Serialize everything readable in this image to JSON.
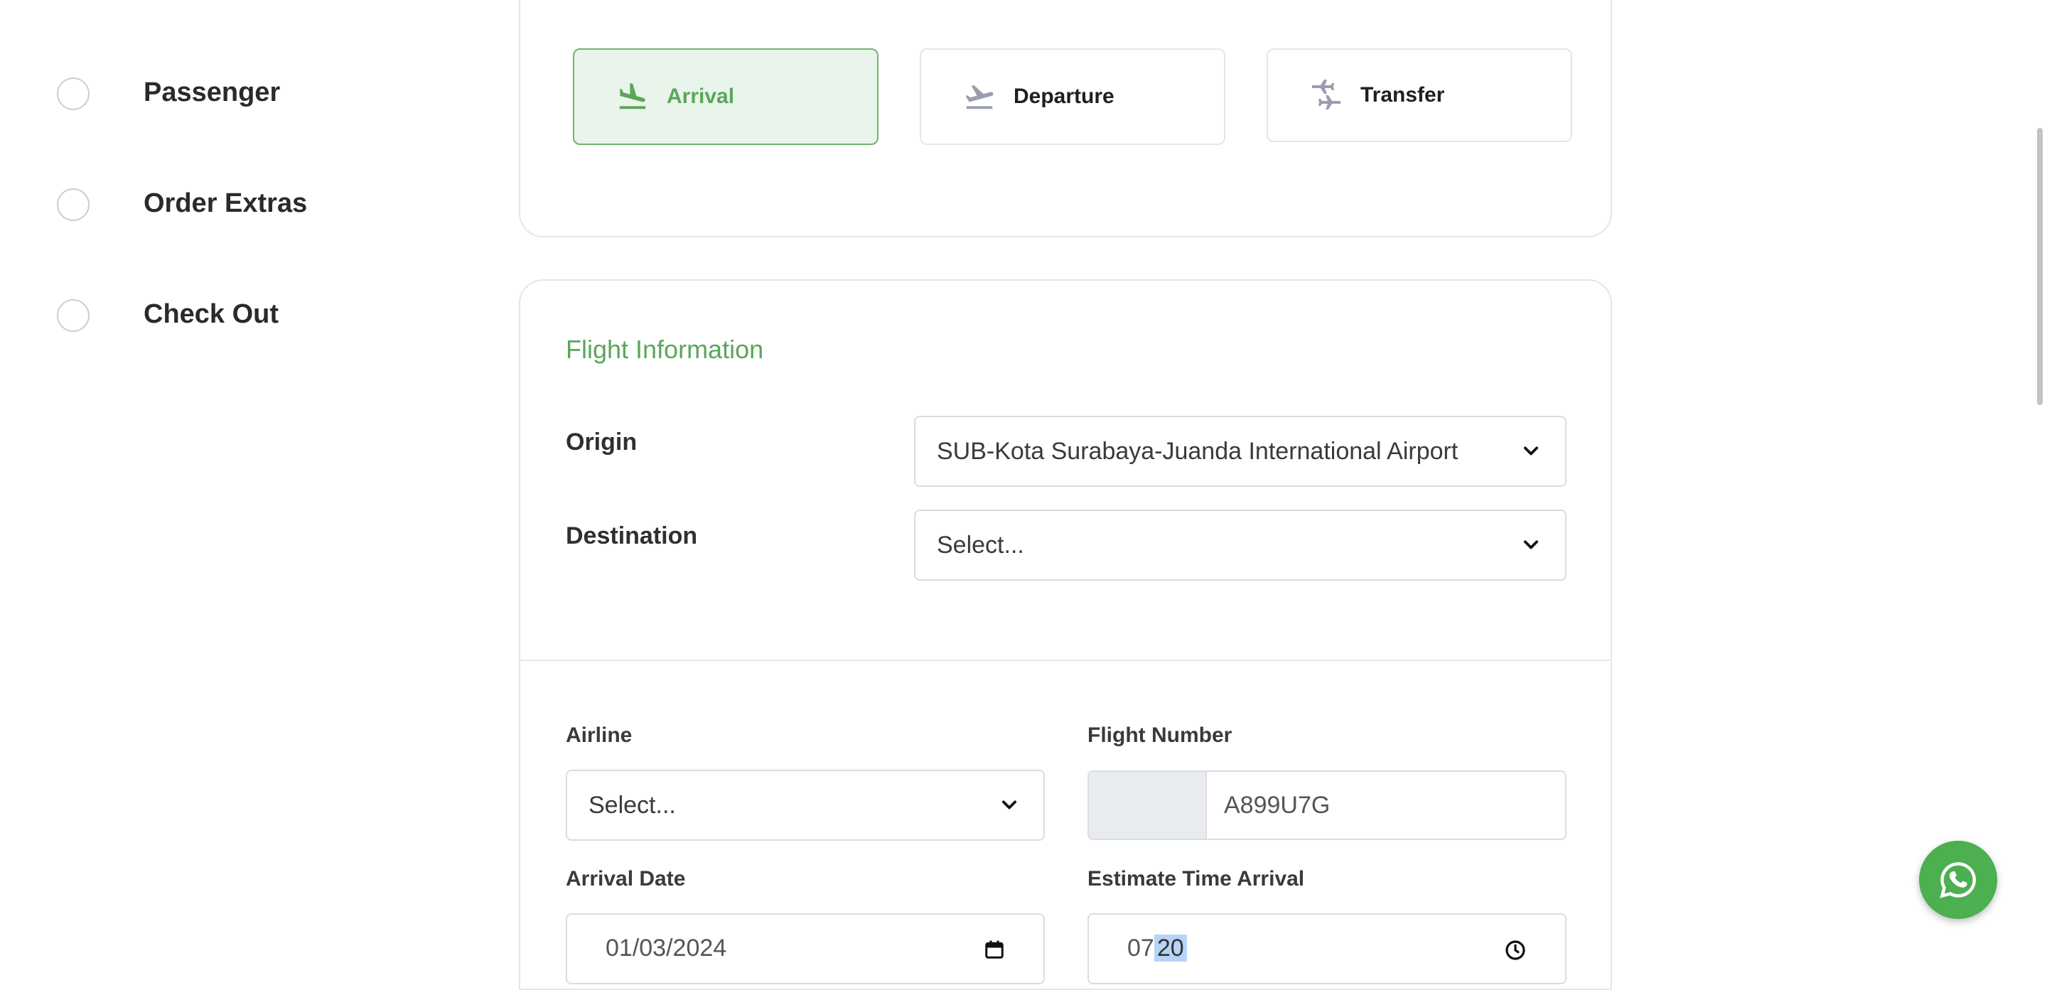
{
  "stepper": {
    "items": [
      {
        "label": "Passenger"
      },
      {
        "label": "Order Extras"
      },
      {
        "label": "Check Out"
      }
    ]
  },
  "trip_type": {
    "options": [
      {
        "label": "Arrival",
        "icon": "plane-landing-icon",
        "active": true
      },
      {
        "label": "Departure",
        "icon": "plane-takeoff-icon",
        "active": false
      },
      {
        "label": "Transfer",
        "icon": "plane-transfer-icon",
        "active": false
      }
    ]
  },
  "flight_info": {
    "title": "Flight Information",
    "origin_label": "Origin",
    "origin_value": "SUB-Kota Surabaya-Juanda International Airport",
    "destination_label": "Destination",
    "destination_value": "Select...",
    "airline_label": "Airline",
    "airline_value": "Select...",
    "flight_number_label": "Flight Number",
    "flight_number_value": "A899U7G",
    "arrival_date_label": "Arrival Date",
    "arrival_date_value": "01/03/2024",
    "eta_label": "Estimate Time Arrival",
    "eta_hour": "07",
    "eta_minute": "20"
  },
  "colors": {
    "accent": "#5aa65a",
    "active_bg": "#e9f4ea",
    "whatsapp": "#4caf50"
  }
}
